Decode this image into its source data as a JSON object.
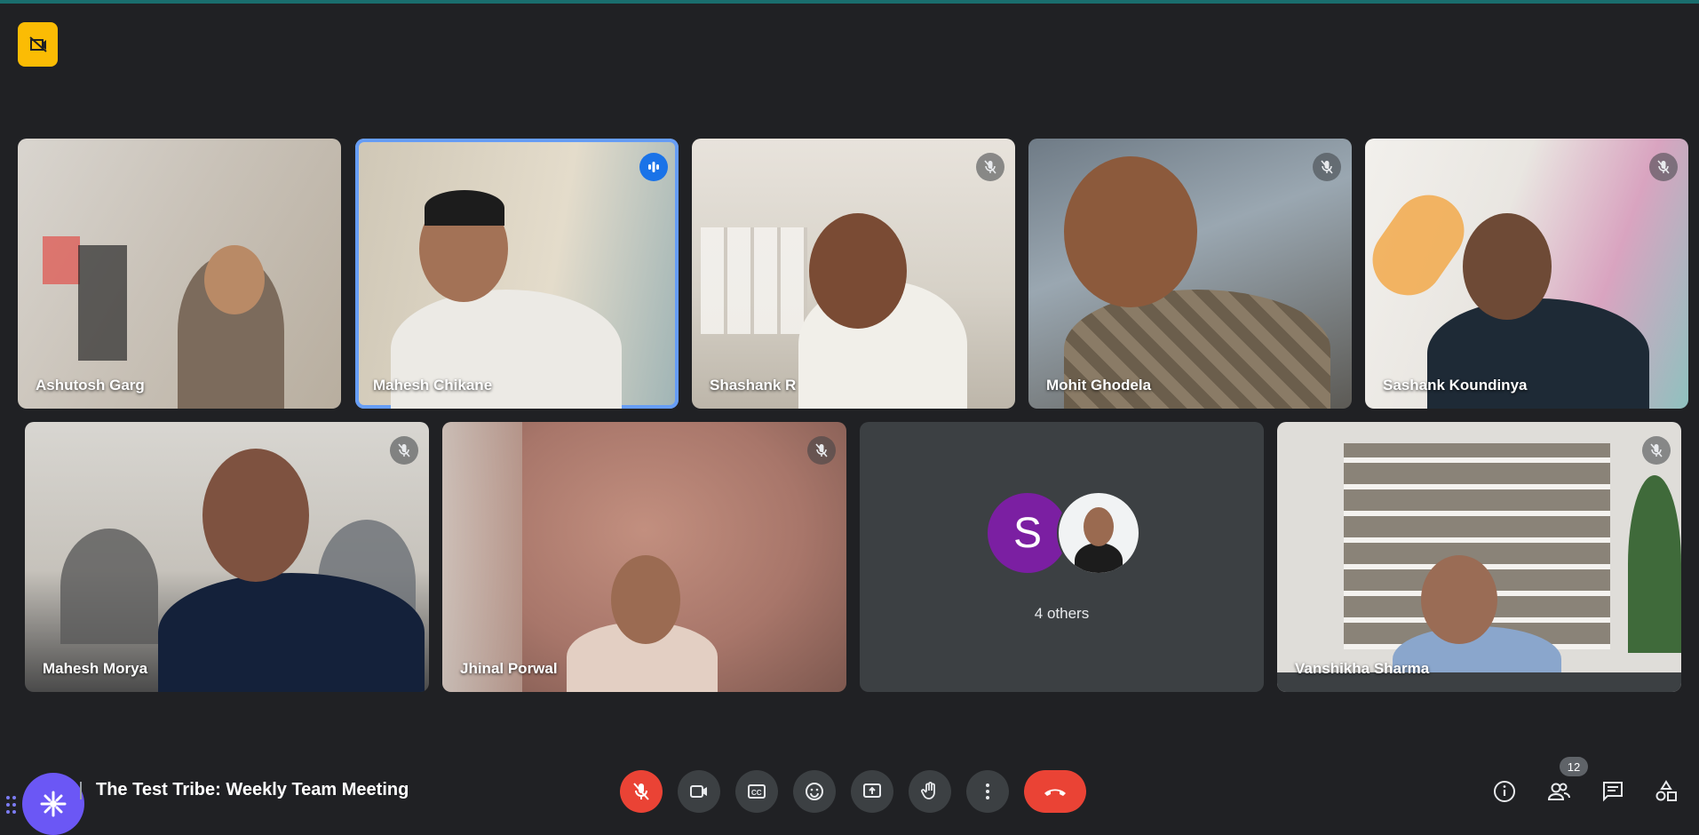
{
  "meeting": {
    "title": "The Test Tribe: Weekly Team Meeting",
    "participant_count": "12"
  },
  "participants": [
    {
      "name": "Ashutosh Garg",
      "muted": false,
      "speaking": false
    },
    {
      "name": "Mahesh Chikane",
      "muted": false,
      "speaking": true
    },
    {
      "name": "Shashank R",
      "muted": true,
      "speaking": false
    },
    {
      "name": "Mohit Ghodela",
      "muted": true,
      "speaking": false
    },
    {
      "name": "Sashank Koundinya",
      "muted": true,
      "speaking": false
    },
    {
      "name": "Mahesh Morya",
      "muted": true,
      "speaking": false
    },
    {
      "name": "Jhinal Porwal",
      "muted": true,
      "speaking": false
    },
    {
      "name": "Vanshikha Sharma",
      "muted": true,
      "speaking": false
    }
  ],
  "others_tile": {
    "initial": "S",
    "label": "4 others"
  },
  "controls": {
    "mic": "mic-off-icon",
    "camera": "videocam-icon",
    "captions": "closed-caption-icon",
    "reactions": "emoji-icon",
    "present": "present-screen-icon",
    "raise_hand": "hand-icon",
    "more": "more-vert-icon",
    "leave": "call-end-icon"
  },
  "colors": {
    "background": "#202124",
    "tile": "#3c4043",
    "danger": "#ea4335",
    "active_border": "#669df6",
    "speaking": "#1a73e8",
    "avatar_purple": "#7b1fa2",
    "alert": "#fbbc04"
  }
}
